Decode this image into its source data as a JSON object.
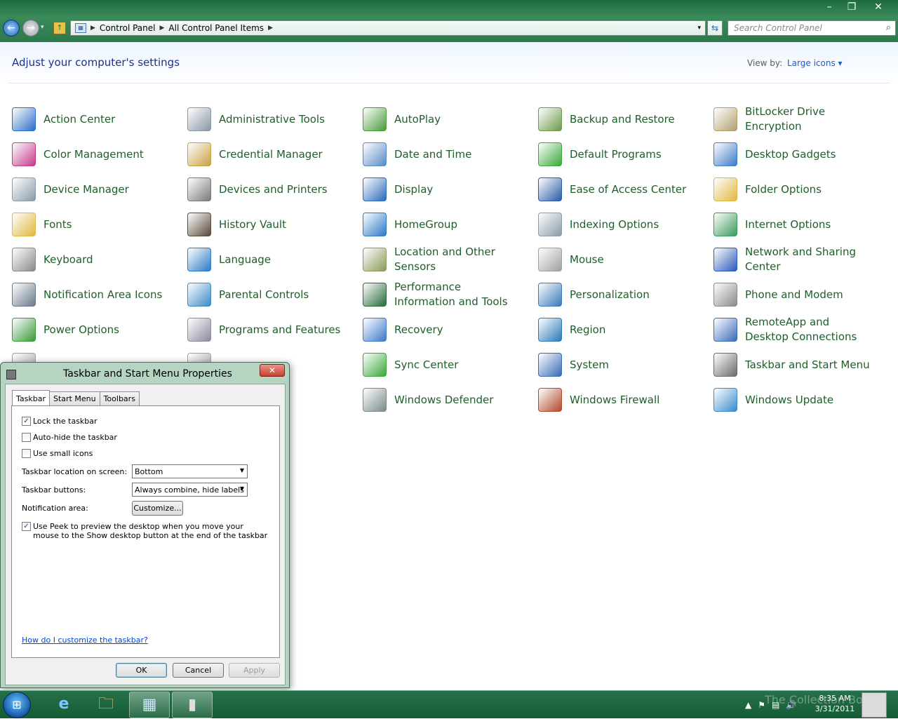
{
  "window": {
    "minimize_glyph": "–",
    "maximize_glyph": "❐",
    "close_glyph": "✕"
  },
  "toolbar": {
    "back_glyph": "←",
    "forward_glyph": "→",
    "history_glyph": "▾",
    "up_glyph": "↑",
    "refresh_glyph": "⇆"
  },
  "address": {
    "crumbs": [
      "Control Panel",
      "All Control Panel Items"
    ],
    "separator": "▶",
    "dropdown": "▾"
  },
  "search": {
    "placeholder": "Search Control Panel",
    "icon": "⌕"
  },
  "header": {
    "title": "Adjust your computer's settings",
    "view_by_label": "View by:",
    "view_by_value": "Large icons ▾"
  },
  "items": [
    {
      "label": "Action Center",
      "icon": "flag-icon",
      "color": "#2a6ec6"
    },
    {
      "label": "Administrative Tools",
      "icon": "gears-checklist-icon",
      "color": "#8a96a6"
    },
    {
      "label": "AutoPlay",
      "icon": "autoplay-icon",
      "color": "#4a9a3a"
    },
    {
      "label": "Backup and Restore",
      "icon": "backup-icon",
      "color": "#6a9a4a"
    },
    {
      "label": "BitLocker Drive Encryption",
      "icon": "key-drive-icon",
      "color": "#b0a070"
    },
    {
      "label": "Color Management",
      "icon": "color-management-icon",
      "color": "#c43a8a"
    },
    {
      "label": "Credential Manager",
      "icon": "vault-icon",
      "color": "#c8a040"
    },
    {
      "label": "Date and Time",
      "icon": "calendar-clock-icon",
      "color": "#5a8ac8"
    },
    {
      "label": "Default Programs",
      "icon": "default-programs-icon",
      "color": "#3aa83a"
    },
    {
      "label": "Desktop Gadgets",
      "icon": "gadgets-icon",
      "color": "#3a7ac8"
    },
    {
      "label": "Device Manager",
      "icon": "device-manager-icon",
      "color": "#8a9aaa"
    },
    {
      "label": "Devices and Printers",
      "icon": "printer-icon",
      "color": "#7a7a7a"
    },
    {
      "label": "Display",
      "icon": "monitor-icon",
      "color": "#2a6ab8"
    },
    {
      "label": "Ease of Access Center",
      "icon": "ease-of-access-icon",
      "color": "#2a5aa8"
    },
    {
      "label": "Folder Options",
      "icon": "folder-options-icon",
      "color": "#e0b840"
    },
    {
      "label": "Fonts",
      "icon": "fonts-folder-icon",
      "color": "#e0b840"
    },
    {
      "label": "History Vault",
      "icon": "history-vault-icon",
      "color": "#5a4a3a"
    },
    {
      "label": "HomeGroup",
      "icon": "homegroup-icon",
      "color": "#2a7ac8"
    },
    {
      "label": "Indexing Options",
      "icon": "indexing-icon",
      "color": "#8a9aa8"
    },
    {
      "label": "Internet Options",
      "icon": "internet-options-icon",
      "color": "#3a9a5a"
    },
    {
      "label": "Keyboard",
      "icon": "keyboard-icon",
      "color": "#8a8a8a"
    },
    {
      "label": "Language",
      "icon": "globe-icon",
      "color": "#2a7ac8"
    },
    {
      "label": "Location and Other Sensors",
      "icon": "sensors-icon",
      "color": "#8a9a5a"
    },
    {
      "label": "Mouse",
      "icon": "mouse-icon",
      "color": "#a0a0a0"
    },
    {
      "label": "Network and Sharing Center",
      "icon": "network-icon",
      "color": "#2a5ab8"
    },
    {
      "label": "Notification Area Icons",
      "icon": "notification-area-icon",
      "color": "#6a7a8a"
    },
    {
      "label": "Parental Controls",
      "icon": "parental-controls-icon",
      "color": "#3a8ac8"
    },
    {
      "label": "Performance Information and Tools",
      "icon": "performance-icon",
      "color": "#2a6a3a"
    },
    {
      "label": "Personalization",
      "icon": "personalization-icon",
      "color": "#3a7ab8"
    },
    {
      "label": "Phone and Modem",
      "icon": "phone-icon",
      "color": "#8a8a8a"
    },
    {
      "label": "Power Options",
      "icon": "power-options-icon",
      "color": "#3a9a3a"
    },
    {
      "label": "Programs and Features",
      "icon": "programs-features-icon",
      "color": "#8a8aa0"
    },
    {
      "label": "Recovery",
      "icon": "recovery-icon",
      "color": "#3a7ac8"
    },
    {
      "label": "Region",
      "icon": "region-clock-icon",
      "color": "#2a7ab8"
    },
    {
      "label": "RemoteApp and Desktop Connections",
      "icon": "remoteapp-icon",
      "color": "#3a6ab8"
    },
    {
      "label": "",
      "icon": "sound-icon",
      "color": "#a0a0a0"
    },
    {
      "label": "",
      "icon": "speech-recognition-icon",
      "color": "#a0a0a0"
    },
    {
      "label": "Sync Center",
      "icon": "sync-center-icon",
      "color": "#3aa83a"
    },
    {
      "label": "System",
      "icon": "system-icon",
      "color": "#3a6ab8"
    },
    {
      "label": "Taskbar and Start Menu",
      "icon": "taskbar-icon",
      "color": "#6a6a6a"
    },
    {
      "label": "",
      "icon": "troubleshooting-icon",
      "color": "#a0a0a0"
    },
    {
      "label": "",
      "icon": "user-accounts-icon",
      "color": "#a0a0a0"
    },
    {
      "label": "Windows Defender",
      "icon": "windows-defender-icon",
      "color": "#7a8a8a"
    },
    {
      "label": "Windows Firewall",
      "icon": "firewall-icon",
      "color": "#b04a2a"
    },
    {
      "label": "Windows Update",
      "icon": "windows-update-icon",
      "color": "#3a8ac8"
    }
  ],
  "dialog": {
    "title": "Taskbar and Start Menu Properties",
    "close_glyph": "✕",
    "tabs": [
      "Taskbar",
      "Start Menu",
      "Toolbars"
    ],
    "lock_taskbar": {
      "label": "Lock the taskbar",
      "checked": true,
      "mark": "✓"
    },
    "auto_hide": {
      "label": "Auto-hide the taskbar",
      "checked": false,
      "mark": ""
    },
    "small_icons": {
      "label": "Use small icons",
      "checked": false,
      "mark": ""
    },
    "location_label": "Taskbar location on screen:",
    "location_value": "Bottom",
    "buttons_label": "Taskbar buttons:",
    "buttons_value": "Always combine, hide labels",
    "notification_label": "Notification area:",
    "customize_label": "Customize...",
    "peek": {
      "label": "Use Peek to preview the desktop when you move your mouse to the Show desktop button at the end of the taskbar",
      "checked": true,
      "mark": "✓"
    },
    "help_link": "How do I customize the taskbar?",
    "ok_label": "OK",
    "cancel_label": "Cancel",
    "apply_label": "Apply",
    "select_arrow": "▼"
  },
  "taskbar": {
    "start_glyph": "⊞",
    "ie_glyph": "e",
    "explorer_glyph": "🗀",
    "controlpanel_glyph": "▦",
    "taskbarprops_glyph": "▮",
    "tray_up": "▲",
    "tray_flag": "⚑",
    "tray_network": "▤",
    "tray_volume": "🔊",
    "time": "8:35 AM",
    "date": "3/31/2011",
    "watermark": "The Collection Book"
  }
}
